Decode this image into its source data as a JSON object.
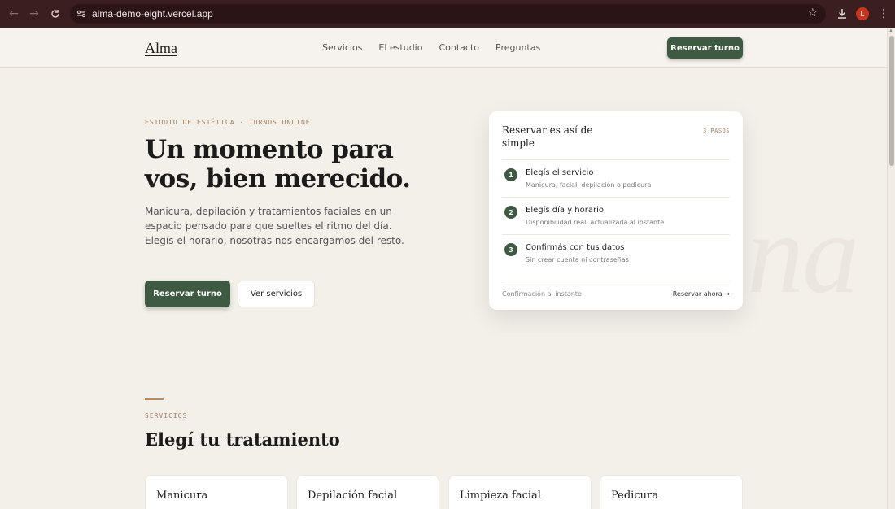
{
  "browser": {
    "url": "alma-demo-eight.vercel.app",
    "profile_initial": "L"
  },
  "nav": {
    "logo": "Alma",
    "links": [
      "Servicios",
      "El estudio",
      "Contacto",
      "Preguntas"
    ],
    "cta": "Reservar turno"
  },
  "hero": {
    "eyebrow": "ESTUDIO DE ESTÉTICA · TURNOS ONLINE",
    "title": "Un momento para vos, bien merecido.",
    "text": "Manicura, depilación y tratamientos faciales en un espacio pensado para que sueltes el ritmo del día. Elegís el horario, nosotras nos encargamos del resto.",
    "primary_button": "Reservar turno",
    "secondary_button": "Ver servicios",
    "watermark": "na"
  },
  "card": {
    "title": "Reservar es así de simple",
    "steps_label": "3 PASOS",
    "steps": [
      {
        "num": "1",
        "title": "Elegís el servicio",
        "subtitle": "Manicura, facial, depilación o pedicura"
      },
      {
        "num": "2",
        "title": "Elegís día y horario",
        "subtitle": "Disponibilidad real, actualizada al instante"
      },
      {
        "num": "3",
        "title": "Confirmás con tus datos",
        "subtitle": "Sin crear cuenta ni contraseñas"
      }
    ],
    "footer_left": "Confirmación al instante",
    "footer_right": "Reservar ahora →"
  },
  "services": {
    "eyebrow": "SERVICIOS",
    "title": "Elegí tu tratamiento",
    "items": [
      "Manicura",
      "Depilación facial",
      "Limpieza facial",
      "Pedicura"
    ]
  },
  "colors": {
    "accent": "#3f5a43",
    "background": "#f3efe9",
    "eyebrow": "#a07d5d",
    "chrome": "#3b1f20"
  }
}
